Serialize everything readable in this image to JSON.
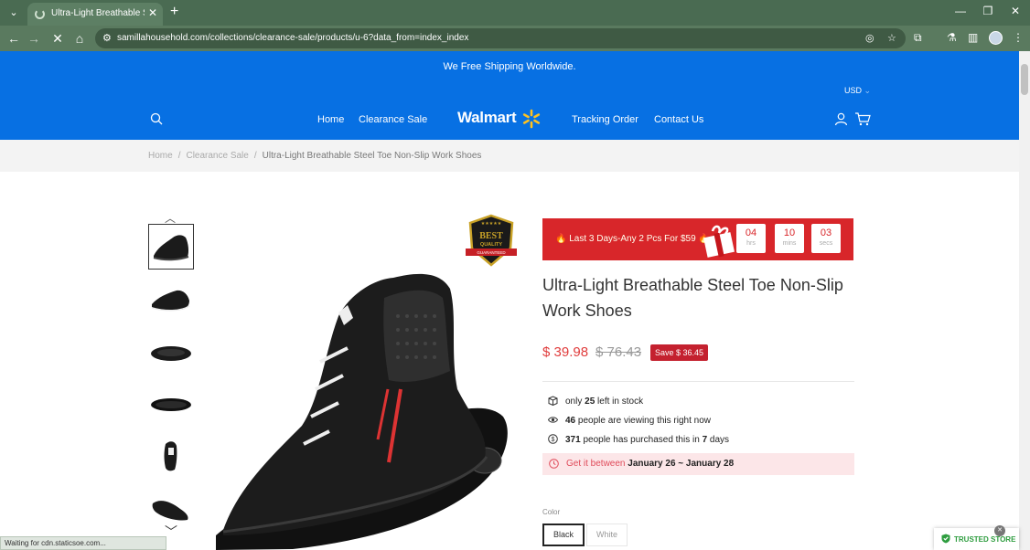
{
  "browser": {
    "tab_title": "Ultra-Light Breathable Steel To",
    "url": "samillahousehold.com/collections/clearance-sale/products/u-6?data_from=index_index",
    "status_text": "Waiting for cdn.staticsoe.com..."
  },
  "header": {
    "shipping_banner": "We Free Shipping Worldwide.",
    "currency": "USD",
    "nav": {
      "home": "Home",
      "clearance": "Clearance Sale",
      "logo": "Walmart",
      "tracking": "Tracking Order",
      "contact": "Contact Us"
    }
  },
  "breadcrumb": {
    "home": "Home",
    "sep1": "/",
    "category": "Clearance Sale",
    "sep2": "/",
    "current": "Ultra-Light Breathable Steel Toe Non-Slip Work Shoes"
  },
  "badge": {
    "line1": "BEST",
    "line2": "QUALITY",
    "line3": "GUARANTEED"
  },
  "promo": {
    "text": "Last 3 Days-Any 2 Pcs For $59",
    "timer": [
      {
        "value": "04",
        "unit": "hrs"
      },
      {
        "value": "10",
        "unit": "mins"
      },
      {
        "value": "03",
        "unit": "secs"
      }
    ]
  },
  "product": {
    "title": "Ultra-Light Breathable Steel Toe Non-Slip Work Shoes",
    "price": "$ 39.98",
    "compare_price": "$ 76.43",
    "save": "Save $ 36.45"
  },
  "stock": {
    "pre": "only",
    "count": "25",
    "post": "left in stock"
  },
  "viewers": {
    "count": "46",
    "post": "people are viewing this right now"
  },
  "purchases": {
    "count": "371",
    "mid": "people has purchased this in",
    "days": "7",
    "post": "days"
  },
  "delivery": {
    "pre": "Get it between",
    "range": "January 26 ~ January 28"
  },
  "options": {
    "color_label": "Color",
    "colors": [
      "Black",
      "White"
    ],
    "selected": "Black"
  },
  "trust": {
    "label": "TRUSTED STORE"
  },
  "colors": {
    "brand_blue": "#0770e3",
    "promo_red": "#d8262a",
    "price_red": "#e03c3c",
    "save_badge": "#c4212f"
  }
}
